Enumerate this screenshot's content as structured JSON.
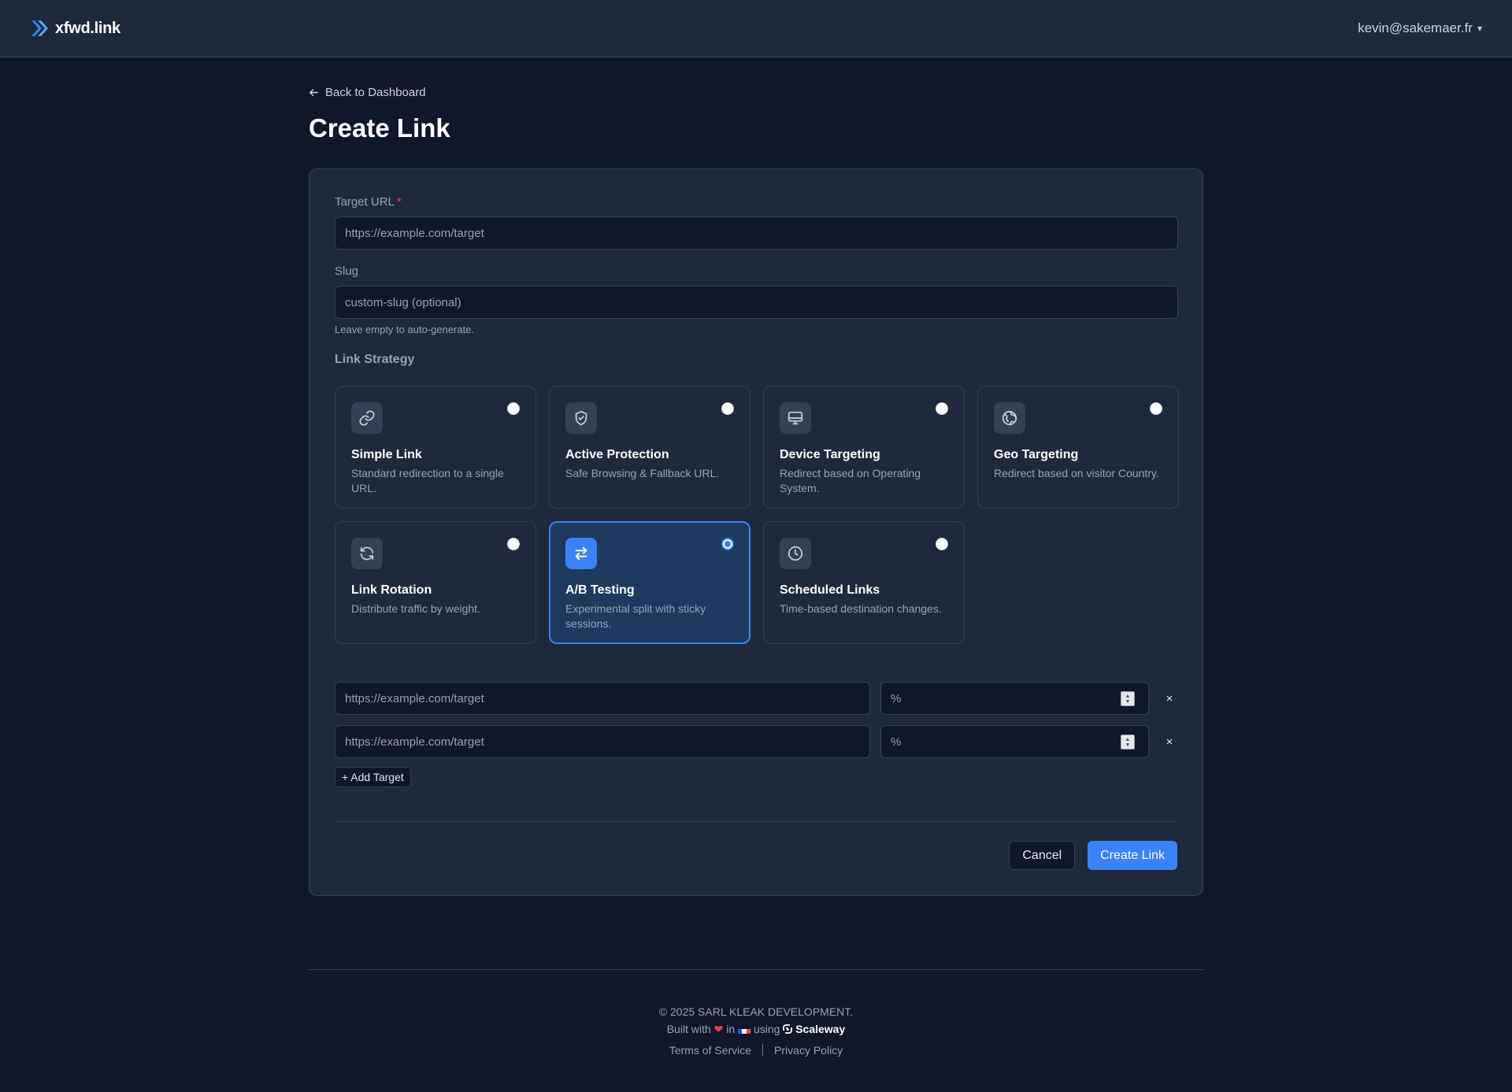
{
  "header": {
    "brand": "xfwd.link",
    "user_email": "kevin@sakemaer.fr",
    "caret": "▾"
  },
  "page": {
    "back_label": "Back to Dashboard",
    "title": "Create Link"
  },
  "form": {
    "target_url": {
      "label": "Target URL",
      "required_mark": "*",
      "placeholder": "https://example.com/target"
    },
    "slug": {
      "label": "Slug",
      "placeholder": "custom-slug (optional)",
      "hint": "Leave empty to auto-generate."
    },
    "strategy_label": "Link Strategy",
    "strategies": [
      {
        "title": "Simple Link",
        "desc": "Standard redirection to a single URL.",
        "icon": "link-icon",
        "selected": false
      },
      {
        "title": "Active Protection",
        "desc": "Safe Browsing & Fallback URL.",
        "icon": "shield-icon",
        "selected": false
      },
      {
        "title": "Device Targeting",
        "desc": "Redirect based on Operating System.",
        "icon": "monitor-icon",
        "selected": false
      },
      {
        "title": "Geo Targeting",
        "desc": "Redirect based on visitor Country.",
        "icon": "globe-icon",
        "selected": false
      },
      {
        "title": "Link Rotation",
        "desc": "Distribute traffic by weight.",
        "icon": "rotate-icon",
        "selected": false
      },
      {
        "title": "A/B Testing",
        "desc": "Experimental split with sticky sessions.",
        "icon": "swap-arrows-icon",
        "selected": true
      },
      {
        "title": "Scheduled Links",
        "desc": "Time-based destination changes.",
        "icon": "clock-icon",
        "selected": false
      }
    ],
    "targets": [
      {
        "url_placeholder": "https://example.com/target",
        "weight_placeholder": "%",
        "remove": "×"
      },
      {
        "url_placeholder": "https://example.com/target",
        "weight_placeholder": "%",
        "remove": "×"
      }
    ],
    "add_target_label": "+ Add Target",
    "cancel_label": "Cancel",
    "submit_label": "Create Link"
  },
  "footer": {
    "copyright": "© 2025 SARL KLEAK DEVELOPMENT.",
    "built_with": "Built with",
    "heart": "❤",
    "in": "in",
    "using": "using",
    "provider": "Scaleway",
    "terms": "Terms of Service",
    "privacy": "Privacy Policy"
  },
  "colors": {
    "background": "#0f172a",
    "surface": "#1e293b",
    "border": "#334155",
    "accent": "#3b82f6",
    "danger": "#ef4444"
  }
}
